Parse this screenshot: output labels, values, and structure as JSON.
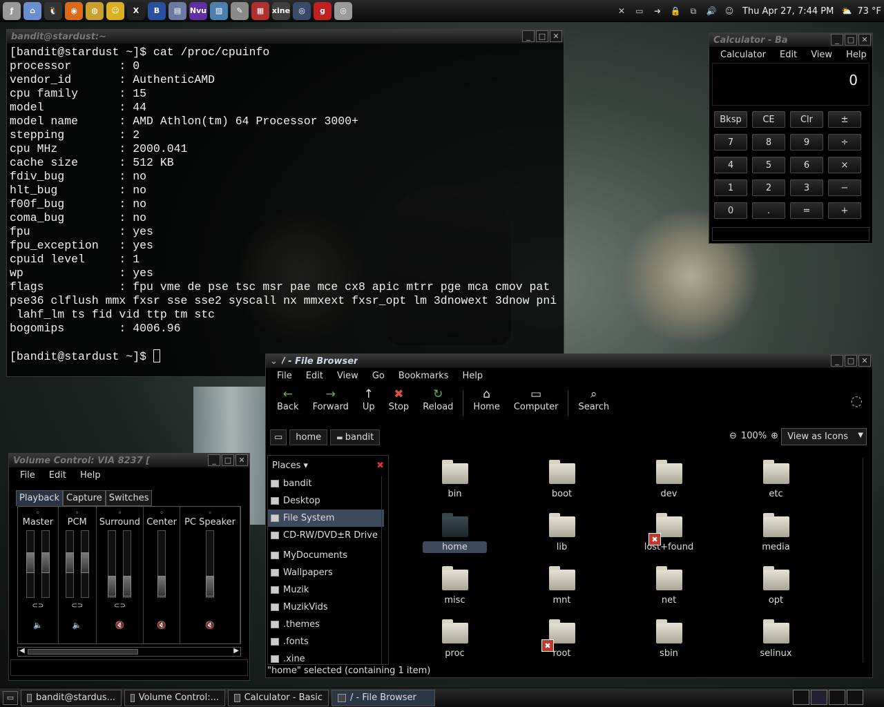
{
  "top_panel": {
    "launchers": [
      {
        "name": "foot-menu-icon",
        "glyph": "ƒ",
        "color": "#999"
      },
      {
        "name": "home-icon",
        "glyph": "⌂",
        "color": "#6a8fd0"
      },
      {
        "name": "tux-icon",
        "glyph": "🐧",
        "color": "#333"
      },
      {
        "name": "firefox-icon",
        "glyph": "◉",
        "color": "#d86a1a"
      },
      {
        "name": "globe-icon",
        "glyph": "◍",
        "color": "#c8a030"
      },
      {
        "name": "gaim-icon",
        "glyph": "☺",
        "color": "#d8b020"
      },
      {
        "name": "xchat-icon",
        "glyph": "X",
        "color": "#222"
      },
      {
        "name": "bitchx-icon",
        "glyph": "B",
        "color": "#2a50a0"
      },
      {
        "name": "gedit-icon",
        "glyph": "▤",
        "color": "#6a7aa0"
      },
      {
        "name": "nvu-icon",
        "glyph": "Nvu",
        "color": "#6030a0"
      },
      {
        "name": "image-icon",
        "glyph": "▨",
        "color": "#4a80b0"
      },
      {
        "name": "writer-icon",
        "glyph": "✎",
        "color": "#8a8a8a"
      },
      {
        "name": "spreadsheet-icon",
        "glyph": "▦",
        "color": "#b03030"
      },
      {
        "name": "xine-icon",
        "glyph": "xine",
        "color": "#404040"
      },
      {
        "name": "xmms-icon",
        "glyph": "◎",
        "color": "#3a4a6a"
      },
      {
        "name": "grip-icon",
        "glyph": "g",
        "color": "#c02020"
      },
      {
        "name": "cd-icon",
        "glyph": "◎",
        "color": "#9a9a9a"
      }
    ],
    "clock": "Thu Apr 27,  7:44 PM",
    "weather": "73 °F",
    "tray": [
      {
        "name": "tools-icon",
        "glyph": "✕"
      },
      {
        "name": "monitor-icon",
        "glyph": "▭"
      },
      {
        "name": "logout-icon",
        "glyph": "➜"
      },
      {
        "name": "lock-icon",
        "glyph": "🔒"
      },
      {
        "name": "network-icon",
        "glyph": "⧉"
      },
      {
        "name": "volume-icon",
        "glyph": "🔊"
      },
      {
        "name": "gaim-tray-icon",
        "glyph": "☺"
      }
    ]
  },
  "terminal": {
    "title": "bandit@stardust:~",
    "lines": [
      "[bandit@stardust ~]$ cat /proc/cpuinfo",
      "processor       : 0",
      "vendor_id       : AuthenticAMD",
      "cpu family      : 15",
      "model           : 44",
      "model name      : AMD Athlon(tm) 64 Processor 3000+",
      "stepping        : 2",
      "cpu MHz         : 2000.041",
      "cache size      : 512 KB",
      "fdiv_bug        : no",
      "hlt_bug         : no",
      "f00f_bug        : no",
      "coma_bug        : no",
      "fpu             : yes",
      "fpu_exception   : yes",
      "cpuid level     : 1",
      "wp              : yes",
      "flags           : fpu vme de pse tsc msr pae mce cx8 apic mtrr pge mca cmov pat",
      "pse36 clflush mmx fxsr sse sse2 syscall nx mmxext fxsr_opt lm 3dnowext 3dnow pni",
      " lahf_lm ts fid vid ttp tm stc",
      "bogomips        : 4006.96",
      "",
      "[bandit@stardust ~]$ "
    ]
  },
  "calculator": {
    "title": "Calculator - Ba",
    "menu": [
      "Calculator",
      "Edit",
      "View",
      "Help"
    ],
    "display": "0",
    "keys": [
      "Bksp",
      "CE",
      "Clr",
      "±",
      "7",
      "8",
      "9",
      "÷",
      "4",
      "5",
      "6",
      "×",
      "1",
      "2",
      "3",
      "−",
      "0",
      ".",
      "=",
      "+"
    ]
  },
  "file_browser": {
    "title": "/ - File Browser",
    "menu": [
      "File",
      "Edit",
      "View",
      "Go",
      "Bookmarks",
      "Help"
    ],
    "toolbar": [
      {
        "label": "Back",
        "icon": "←",
        "name": "back-button"
      },
      {
        "label": "Forward",
        "icon": "→",
        "name": "forward-button"
      },
      {
        "label": "Up",
        "icon": "↑",
        "name": "up-button"
      },
      {
        "label": "Stop",
        "icon": "✖",
        "name": "stop-button"
      },
      {
        "label": "Reload",
        "icon": "↻",
        "name": "reload-button"
      },
      {
        "label": "Home",
        "icon": "⌂",
        "name": "home-button"
      },
      {
        "label": "Computer",
        "icon": "▭",
        "name": "computer-button"
      },
      {
        "label": "Search",
        "icon": "⌕",
        "name": "search-button"
      }
    ],
    "breadcrumbs": [
      "home",
      "bandit"
    ],
    "zoom": "100%",
    "view_as": "View as Icons",
    "places_label": "Places",
    "places": [
      {
        "label": "bandit",
        "selected": false
      },
      {
        "label": "Desktop",
        "selected": false
      },
      {
        "label": "File System",
        "selected": true
      },
      {
        "label": "CD-RW/DVD±R Drive",
        "selected": false
      },
      {
        "label": "MyDocuments",
        "selected": false
      },
      {
        "label": "Wallpapers",
        "selected": false
      },
      {
        "label": "Muzik",
        "selected": false
      },
      {
        "label": "MuzikVids",
        "selected": false
      },
      {
        "label": ".themes",
        "selected": false
      },
      {
        "label": ".fonts",
        "selected": false
      },
      {
        "label": ".xine",
        "selected": false
      }
    ],
    "files": [
      {
        "name": "bin",
        "locked": false,
        "selected": false
      },
      {
        "name": "boot",
        "locked": false,
        "selected": false
      },
      {
        "name": "dev",
        "locked": false,
        "selected": false
      },
      {
        "name": "etc",
        "locked": false,
        "selected": false
      },
      {
        "name": "home",
        "locked": false,
        "selected": true
      },
      {
        "name": "lib",
        "locked": false,
        "selected": false
      },
      {
        "name": "lost+found",
        "locked": true,
        "selected": false
      },
      {
        "name": "media",
        "locked": false,
        "selected": false
      },
      {
        "name": "misc",
        "locked": false,
        "selected": false
      },
      {
        "name": "mnt",
        "locked": false,
        "selected": false
      },
      {
        "name": "net",
        "locked": false,
        "selected": false
      },
      {
        "name": "opt",
        "locked": false,
        "selected": false
      },
      {
        "name": "proc",
        "locked": false,
        "selected": false
      },
      {
        "name": "root",
        "locked": true,
        "selected": false
      },
      {
        "name": "sbin",
        "locked": false,
        "selected": false
      },
      {
        "name": "selinux",
        "locked": false,
        "selected": false
      }
    ],
    "status": "\"home\" selected (containing 1 item)"
  },
  "volume": {
    "title": "Volume Control: VIA 8237 [",
    "menu": [
      "File",
      "Edit",
      "Help"
    ],
    "tabs": [
      "Playback",
      "Capture",
      "Switches"
    ],
    "channels": [
      {
        "label": "Master",
        "levels": [
          0.55,
          0.55
        ],
        "muted": false
      },
      {
        "label": "PCM",
        "levels": [
          0.55,
          0.55
        ],
        "muted": false
      },
      {
        "label": "Surround",
        "levels": [
          0.05,
          0.05
        ],
        "muted": true
      },
      {
        "label": "Center",
        "levels": [
          0.05
        ],
        "muted": true
      },
      {
        "label": "PC Speaker",
        "levels": [
          0.05
        ],
        "muted": true
      }
    ]
  },
  "taskbar": [
    {
      "label": "bandit@stardus...",
      "active": false
    },
    {
      "label": "Volume Control:...",
      "active": false
    },
    {
      "label": "Calculator  - Basic",
      "active": false
    },
    {
      "label": "/ - File Browser",
      "active": true
    }
  ]
}
